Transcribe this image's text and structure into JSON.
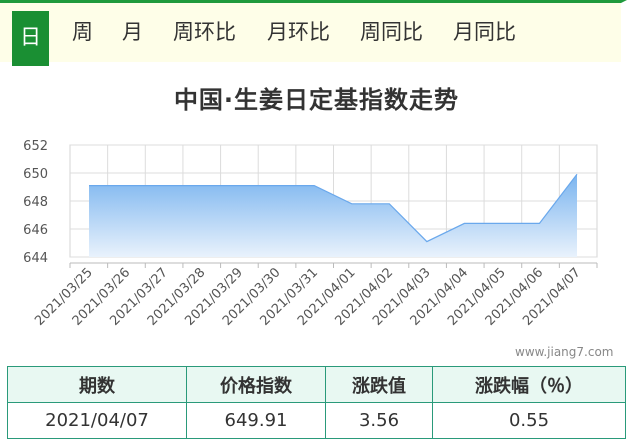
{
  "tabs": [
    {
      "label": "日",
      "active": true
    },
    {
      "label": "周",
      "active": false
    },
    {
      "label": "月",
      "active": false
    },
    {
      "label": "周环比",
      "active": false
    },
    {
      "label": "月环比",
      "active": false
    },
    {
      "label": "周同比",
      "active": false
    },
    {
      "label": "月同比",
      "active": false
    }
  ],
  "watermark": "www.jiang7.com",
  "chart_data": {
    "type": "area",
    "title": "中国·生姜日定基指数走势",
    "xlabel": "",
    "ylabel": "",
    "x": [
      "2021/03/25",
      "2021/03/26",
      "2021/03/27",
      "2021/03/28",
      "2021/03/29",
      "2021/03/30",
      "2021/03/31",
      "2021/04/01",
      "2021/04/02",
      "2021/04/03",
      "2021/04/04",
      "2021/04/05",
      "2021/04/06",
      "2021/04/07"
    ],
    "series": [
      {
        "values": [
          649.1,
          649.1,
          649.1,
          649.1,
          649.1,
          649.1,
          649.1,
          647.8,
          647.8,
          645.1,
          646.4,
          646.4,
          646.4,
          649.91
        ]
      }
    ],
    "y_ticks": [
      644,
      646,
      648,
      650,
      652
    ],
    "ylim": [
      644,
      652
    ],
    "grid": true,
    "colors": {
      "fill_top": "#7ab4ef",
      "fill_bottom": "#e9f2fc",
      "line": "#6aa8ec"
    }
  },
  "table": {
    "headers": [
      "期数",
      "价格指数",
      "涨跌值",
      "涨跌幅（％）"
    ],
    "rows": [
      [
        "2021/04/07",
        "649.91",
        "3.56",
        "0.55"
      ]
    ]
  }
}
